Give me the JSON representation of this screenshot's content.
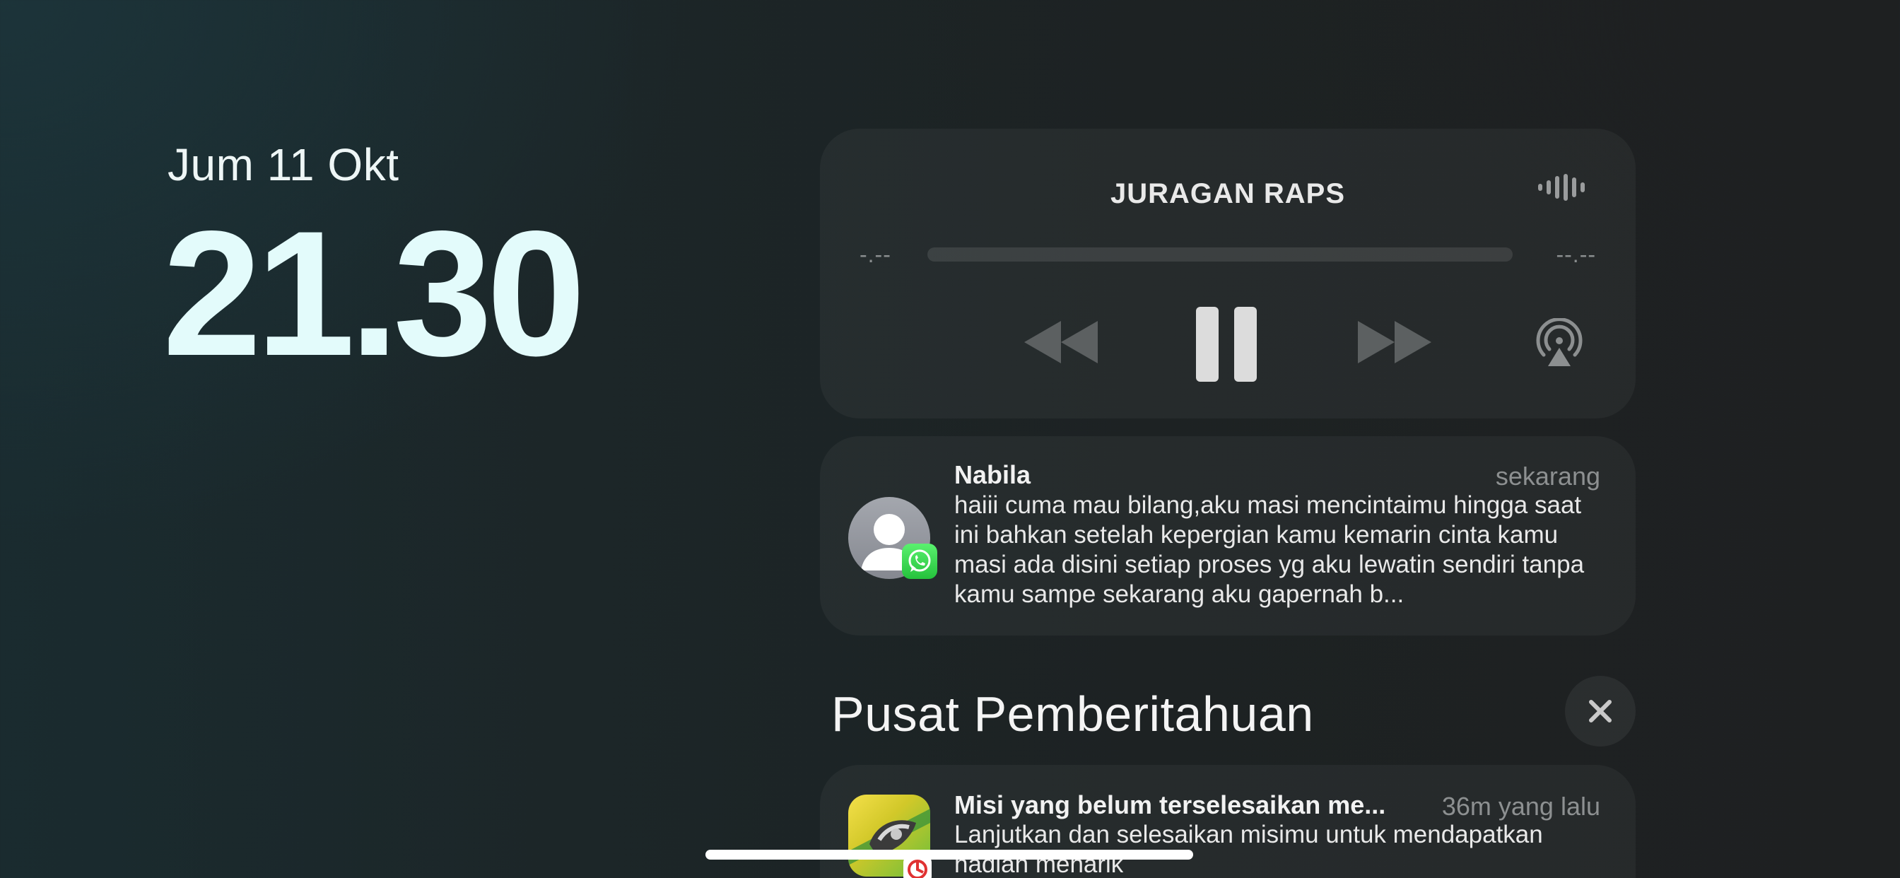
{
  "lock": {
    "date": "Jum 11 Okt",
    "time": "21.30"
  },
  "player": {
    "title": "JURAGAN RAPS",
    "elapsed": "-.--",
    "remaining": "--.--",
    "progress": 0,
    "icons": [
      "waveform-icon",
      "rewind-icon",
      "pause-icon",
      "fast-forward-icon",
      "airplay-icon"
    ]
  },
  "notification": {
    "sender": "Nabila",
    "time": "sekarang",
    "body": "haiii cuma mau bilang,aku masi mencintaimu hingga saat ini bahkan setelah kepergian kamu kemarin cinta kamu masi ada disini setiap proses yg aku lewatin sendiri tanpa kamu sampe sekarang aku gapernah b...",
    "app_icon": "whatsapp-icon"
  },
  "notification_center": {
    "title": "Pusat Pemberitahuan",
    "close_icon": "close-icon",
    "items": [
      {
        "title": "Misi yang belum terselesaikan me...",
        "time": "36m yang lalu",
        "body": "Lanjutkan dan selesaikan misimu untuk mendapatkan hadiah menarik",
        "app_icon": "game-app-icon"
      }
    ]
  },
  "colors": {
    "accent_text": "#e3fbfb",
    "secondary_text": "#8d9091",
    "card_bg": "rgba(255,255,255,0.045)",
    "whatsapp_green": "#25c23c"
  }
}
